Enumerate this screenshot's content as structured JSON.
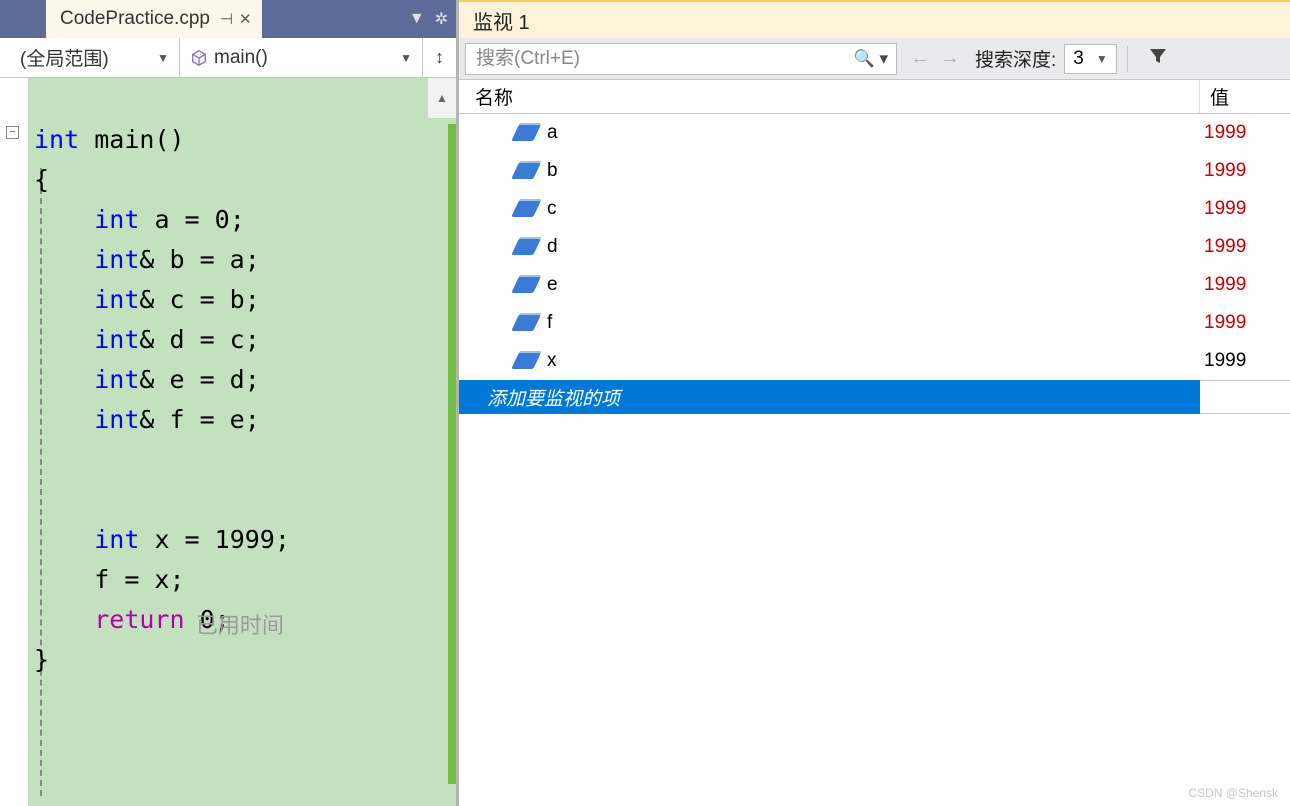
{
  "editor": {
    "tab_title": "CodePractice.cpp",
    "scope_left": "(全局范围)",
    "scope_right": "main()",
    "code_lines": [
      {
        "pre": "",
        "tokens": [
          {
            "t": "int ",
            "c": "kw"
          },
          {
            "t": "main()",
            "c": ""
          }
        ]
      },
      {
        "pre": "",
        "tokens": [
          {
            "t": "{",
            "c": ""
          }
        ]
      },
      {
        "pre": "    ",
        "tokens": [
          {
            "t": "int ",
            "c": "kw"
          },
          {
            "t": "a = 0;",
            "c": ""
          }
        ]
      },
      {
        "pre": "    ",
        "tokens": [
          {
            "t": "int",
            "c": "kw"
          },
          {
            "t": "& b = a;",
            "c": ""
          }
        ]
      },
      {
        "pre": "    ",
        "tokens": [
          {
            "t": "int",
            "c": "kw"
          },
          {
            "t": "& c = b;",
            "c": ""
          }
        ]
      },
      {
        "pre": "    ",
        "tokens": [
          {
            "t": "int",
            "c": "kw"
          },
          {
            "t": "& d = c;",
            "c": ""
          }
        ]
      },
      {
        "pre": "    ",
        "tokens": [
          {
            "t": "int",
            "c": "kw"
          },
          {
            "t": "& e = d;",
            "c": ""
          }
        ]
      },
      {
        "pre": "    ",
        "tokens": [
          {
            "t": "int",
            "c": "kw"
          },
          {
            "t": "& f = e;",
            "c": ""
          }
        ]
      },
      {
        "pre": "",
        "tokens": []
      },
      {
        "pre": "",
        "tokens": []
      },
      {
        "pre": "    ",
        "tokens": [
          {
            "t": "int ",
            "c": "kw"
          },
          {
            "t": "x = 1999;",
            "c": ""
          }
        ]
      },
      {
        "pre": "    ",
        "tokens": [
          {
            "t": "f = x;",
            "c": ""
          }
        ]
      },
      {
        "pre": "    ",
        "tokens": [
          {
            "t": "return",
            "c": "ret"
          },
          {
            "t": " 0;",
            "c": ""
          }
        ],
        "hl": true,
        "annot": "已用时间"
      },
      {
        "pre": "",
        "tokens": [
          {
            "t": "}",
            "c": ""
          }
        ]
      }
    ]
  },
  "watch": {
    "title": "监视 1",
    "search_placeholder": "搜索(Ctrl+E)",
    "depth_label": "搜索深度:",
    "depth_value": "3",
    "col_name": "名称",
    "col_value": "值",
    "rows": [
      {
        "name": "a",
        "value": "1999",
        "changed": true
      },
      {
        "name": "b",
        "value": "1999",
        "changed": true
      },
      {
        "name": "c",
        "value": "1999",
        "changed": true
      },
      {
        "name": "d",
        "value": "1999",
        "changed": true
      },
      {
        "name": "e",
        "value": "1999",
        "changed": true
      },
      {
        "name": "f",
        "value": "1999",
        "changed": true
      },
      {
        "name": "x",
        "value": "1999",
        "changed": false
      }
    ],
    "add_item_label": "添加要监视的项"
  },
  "watermark": "CSDN @Shensk"
}
